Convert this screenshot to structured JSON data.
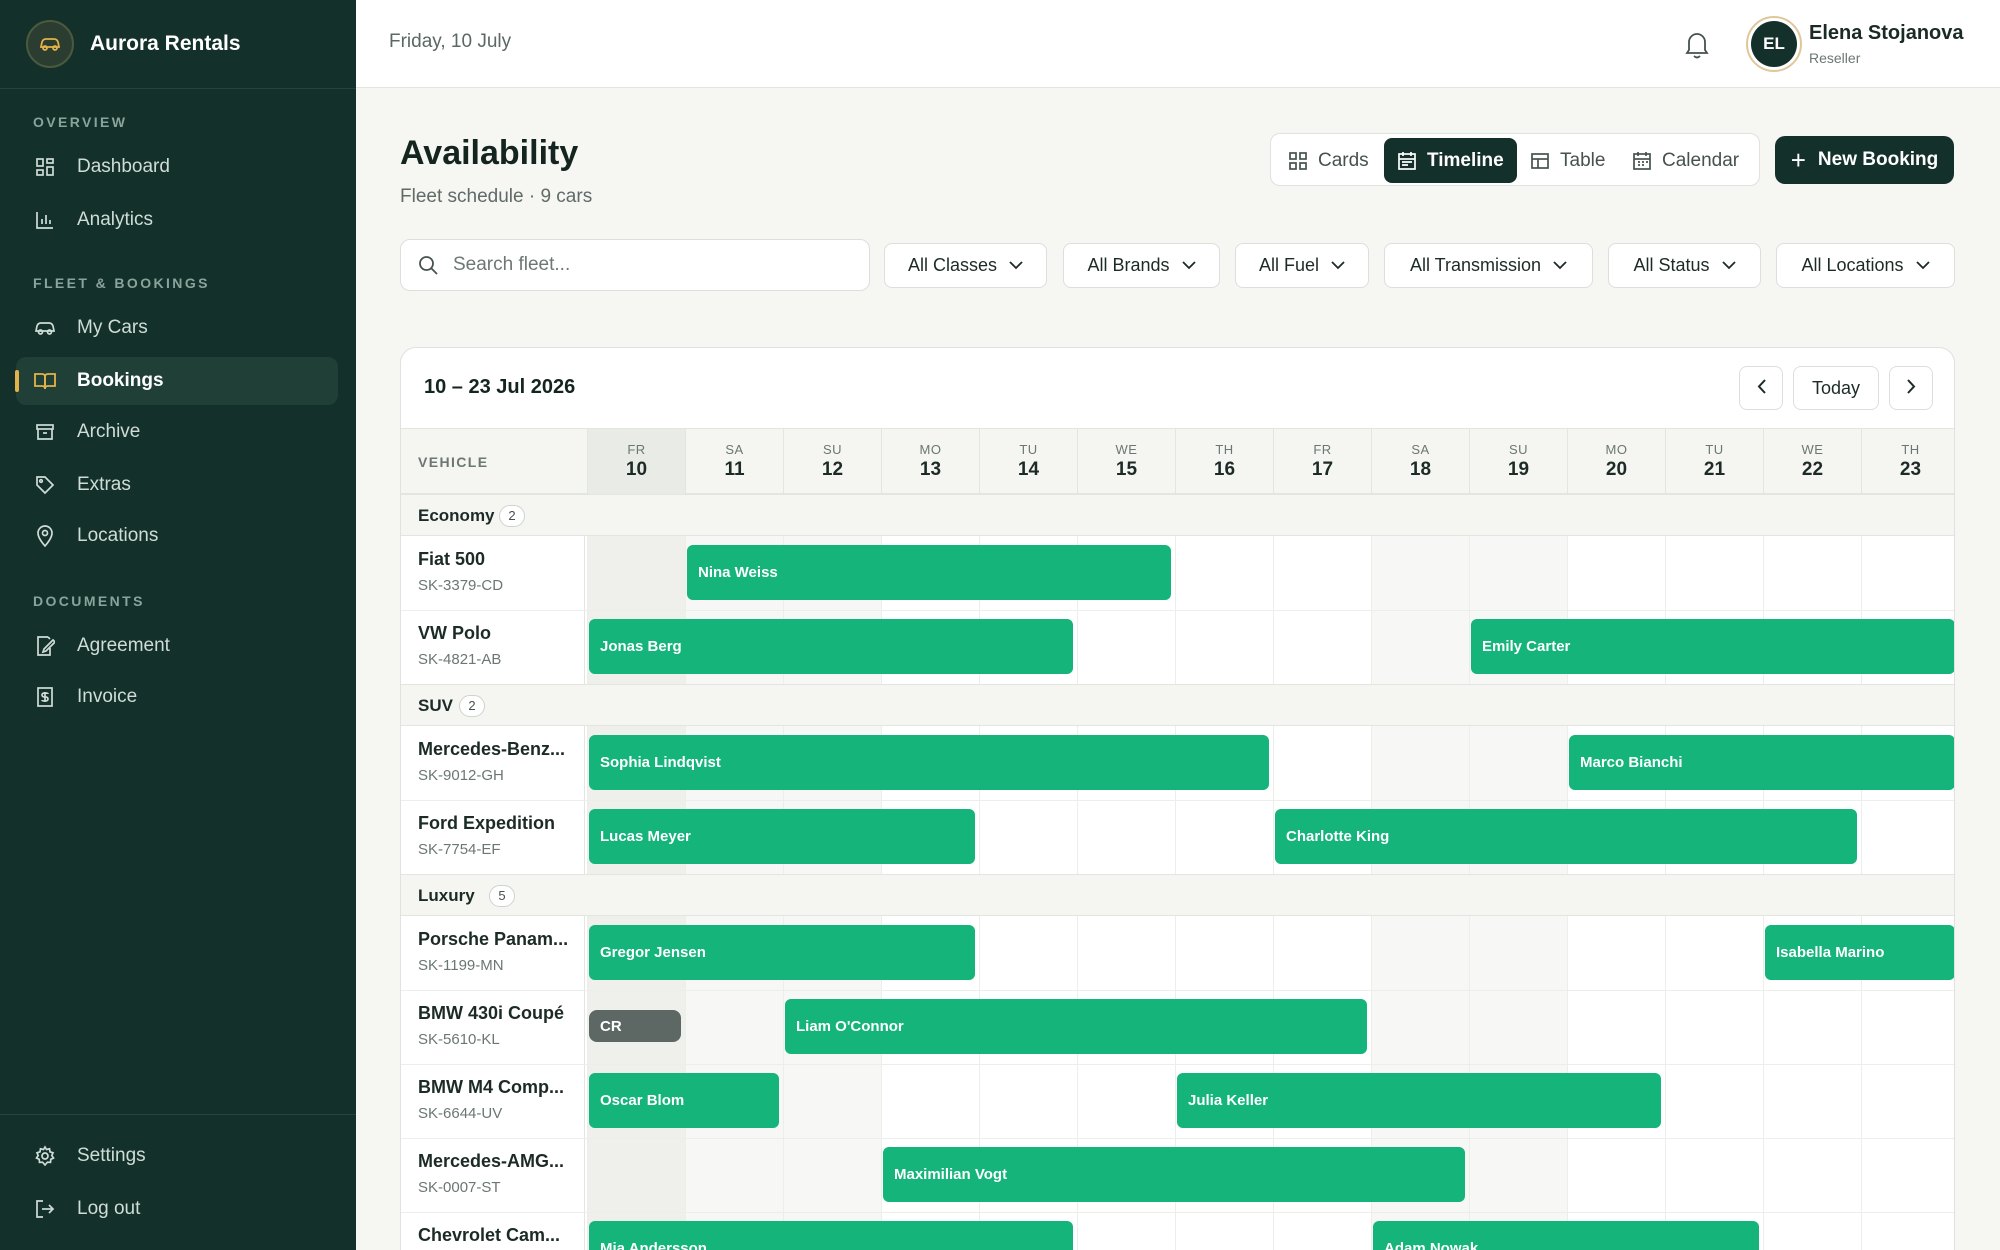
{
  "app": {
    "name": "Aurora Rentals",
    "logo_icon": "car-icon"
  },
  "sidebar": {
    "sections": [
      {
        "label": "OVERVIEW",
        "items": [
          {
            "label": "Dashboard",
            "icon": "dashboard-icon"
          },
          {
            "label": "Analytics",
            "icon": "analytics-icon"
          }
        ]
      },
      {
        "label": "FLEET & BOOKINGS",
        "items": [
          {
            "label": "My Cars",
            "icon": "car-icon"
          },
          {
            "label": "Bookings",
            "icon": "book-icon",
            "active": true
          },
          {
            "label": "Archive",
            "icon": "archive-icon"
          },
          {
            "label": "Extras",
            "icon": "tag-icon"
          },
          {
            "label": "Locations",
            "icon": "location-pin-icon"
          }
        ]
      },
      {
        "label": "DOCUMENTS",
        "items": [
          {
            "label": "Agreement",
            "icon": "document-edit-icon"
          },
          {
            "label": "Invoice",
            "icon": "invoice-icon"
          }
        ]
      }
    ],
    "footer": [
      {
        "label": "Settings",
        "icon": "gear-icon"
      },
      {
        "label": "Log out",
        "icon": "logout-icon"
      }
    ]
  },
  "header": {
    "date": "Friday, 10 July",
    "user": {
      "initials": "EL",
      "name": "Elena Stojanova",
      "role": "Reseller"
    }
  },
  "page": {
    "title": "Availability",
    "subtitle": "Fleet schedule · 9 cars",
    "views": [
      "Cards",
      "Timeline",
      "Table",
      "Calendar"
    ],
    "active_view": "Timeline",
    "new_booking": "New Booking"
  },
  "filters": {
    "search_placeholder": "Search fleet...",
    "dropdowns": [
      "All Classes",
      "All Brands",
      "All Fuel",
      "All Transmission",
      "All Status",
      "All Locations"
    ]
  },
  "timeline": {
    "range": "10 – 23 Jul 2026",
    "today_label": "Today",
    "vehicle_header": "VEHICLE",
    "days": [
      {
        "abbr": "FR",
        "num": "10",
        "today": true
      },
      {
        "abbr": "SA",
        "num": "11",
        "weekend": true
      },
      {
        "abbr": "SU",
        "num": "12",
        "weekend": true
      },
      {
        "abbr": "MO",
        "num": "13"
      },
      {
        "abbr": "TU",
        "num": "14"
      },
      {
        "abbr": "WE",
        "num": "15"
      },
      {
        "abbr": "TH",
        "num": "16"
      },
      {
        "abbr": "FR",
        "num": "17"
      },
      {
        "abbr": "SA",
        "num": "18",
        "weekend": true
      },
      {
        "abbr": "SU",
        "num": "19",
        "weekend": true
      },
      {
        "abbr": "MO",
        "num": "20"
      },
      {
        "abbr": "TU",
        "num": "21"
      },
      {
        "abbr": "WE",
        "num": "22"
      },
      {
        "abbr": "TH",
        "num": "23"
      }
    ],
    "groups": [
      {
        "name": "Economy",
        "count": "2",
        "cars": [
          {
            "name": "Fiat 500",
            "plate": "SK-3379-CD",
            "bookings": [
              {
                "name": "Nina Weiss",
                "start": 11,
                "end": 15
              }
            ]
          },
          {
            "name": "VW Polo",
            "plate": "SK-4821-AB",
            "bookings": [
              {
                "name": "Jonas Berg",
                "start": 10,
                "end": 14
              },
              {
                "name": "Emily Carter",
                "start": 19,
                "end": 23
              }
            ]
          }
        ]
      },
      {
        "name": "SUV",
        "count": "2",
        "cars": [
          {
            "name": "Mercedes-Benz...",
            "plate": "SK-9012-GH",
            "bookings": [
              {
                "name": "Sophia Lindqvist",
                "start": 10,
                "end": 16
              },
              {
                "name": "Marco Bianchi",
                "start": 20,
                "end": 23
              }
            ]
          },
          {
            "name": "Ford Expedition",
            "plate": "SK-7754-EF",
            "bookings": [
              {
                "name": "Lucas Meyer",
                "start": 10,
                "end": 13
              },
              {
                "name": "Charlotte King",
                "start": 17,
                "end": 22
              }
            ]
          }
        ]
      },
      {
        "name": "Luxury",
        "count": "5",
        "cars": [
          {
            "name": "Porsche Panam...",
            "plate": "SK-1199-MN",
            "bookings": [
              {
                "name": "Gregor Jensen",
                "start": 10,
                "end": 13
              },
              {
                "name": "Isabella Marino",
                "start": 22,
                "end": 23
              }
            ]
          },
          {
            "name": "BMW 430i Coupé",
            "plate": "SK-5610-KL",
            "bookings": [
              {
                "name": "CR",
                "start": 10,
                "end": 10,
                "style": "grey"
              },
              {
                "name": "Liam O'Connor",
                "start": 12,
                "end": 17
              }
            ]
          },
          {
            "name": "BMW M4 Comp...",
            "plate": "SK-6644-UV",
            "bookings": [
              {
                "name": "Oscar Blom",
                "start": 10,
                "end": 11
              },
              {
                "name": "Julia Keller",
                "start": 16,
                "end": 20
              }
            ]
          },
          {
            "name": "Mercedes-AMG...",
            "plate": "SK-0007-ST",
            "bookings": [
              {
                "name": "Maximilian Vogt",
                "start": 13,
                "end": 18
              }
            ]
          },
          {
            "name": "Chevrolet Cam...",
            "plate": "",
            "bookings": [
              {
                "name": "Mia Andersson",
                "start": 10,
                "end": 14
              },
              {
                "name": "Adam Nowak",
                "start": 18,
                "end": 21
              }
            ]
          }
        ]
      }
    ]
  },
  "colors": {
    "sidebar": "#14302a",
    "accent": "#14b47a",
    "primary_button": "#14302a",
    "active_marker": "#e3b34a"
  }
}
